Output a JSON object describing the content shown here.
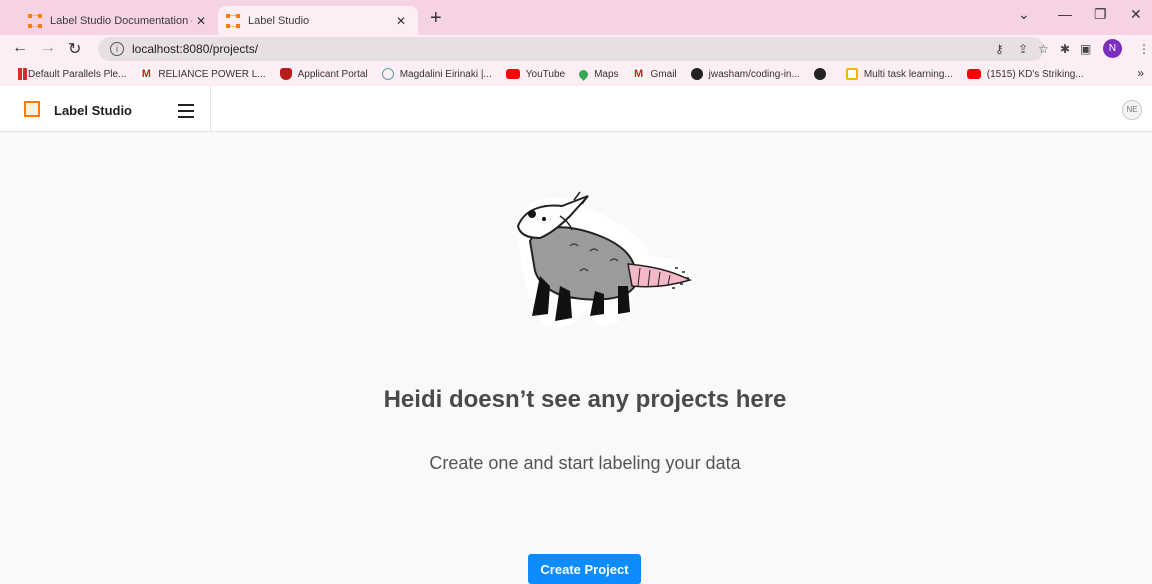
{
  "browser": {
    "tabs": [
      {
        "title": "Label Studio Documentation — (",
        "active": false
      },
      {
        "title": "Label Studio",
        "active": true
      }
    ],
    "url": "localhost:8080/projects/",
    "profile_initial": "N",
    "bookmarks": [
      {
        "label": "Default Parallels Ple...",
        "icon": "parallels-icon",
        "color": "#d32f2f"
      },
      {
        "label": "RELIANCE POWER L...",
        "icon": "gmail-icon",
        "color": "#c5221f"
      },
      {
        "label": "Applicant Portal",
        "icon": "shield-icon",
        "color": "#b71c1c"
      },
      {
        "label": "Magdalini Eirinaki |...",
        "icon": "scholar-icon",
        "color": "#5f9ea0"
      },
      {
        "label": "YouTube",
        "icon": "youtube-icon",
        "color": "#ff0000"
      },
      {
        "label": "Maps",
        "icon": "maps-pin-icon",
        "color": "#34a853"
      },
      {
        "label": "Gmail",
        "icon": "gmail-icon",
        "color": "#c5221f"
      },
      {
        "label": "jwasham/coding-in...",
        "icon": "github-icon",
        "color": "#222222"
      },
      {
        "label": "",
        "icon": "github-icon",
        "color": "#222222"
      },
      {
        "label": "Multi task learning...",
        "icon": "folder-icon",
        "color": "#f2b400"
      },
      {
        "label": "(1515) KD's Striking...",
        "icon": "youtube-icon",
        "color": "#ff0000"
      }
    ]
  },
  "app": {
    "title": "Label Studio",
    "user_initials": "NE"
  },
  "empty_state": {
    "title": "Heidi doesn’t see any projects here",
    "subtitle": "Create one and start labeling your data",
    "button_label": "Create Project"
  },
  "colors": {
    "accent": "#0c8cff",
    "logo": "#ff7a00",
    "tabstrip": "#f6d3e3"
  }
}
